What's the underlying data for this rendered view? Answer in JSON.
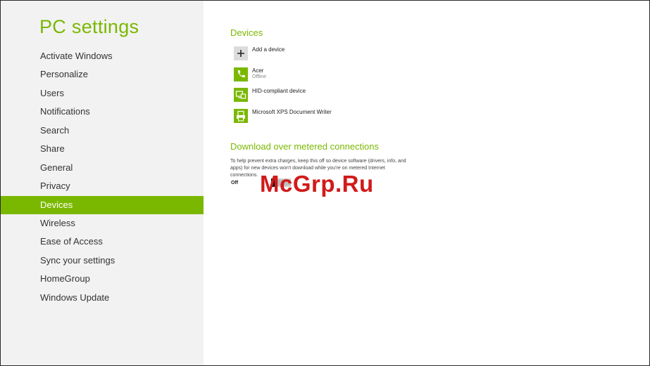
{
  "app_title": "PC settings",
  "nav": {
    "items": [
      {
        "label": "Activate Windows"
      },
      {
        "label": "Personalize"
      },
      {
        "label": "Users"
      },
      {
        "label": "Notifications"
      },
      {
        "label": "Search"
      },
      {
        "label": "Share"
      },
      {
        "label": "General"
      },
      {
        "label": "Privacy"
      },
      {
        "label": "Devices",
        "selected": true
      },
      {
        "label": "Wireless"
      },
      {
        "label": "Ease of Access"
      },
      {
        "label": "Sync your settings"
      },
      {
        "label": "HomeGroup"
      },
      {
        "label": "Windows Update"
      }
    ]
  },
  "devices": {
    "title": "Devices",
    "add_label": "Add a device",
    "list": [
      {
        "name": "Acer",
        "status": "Offline",
        "icon": "phone-icon"
      },
      {
        "name": "HID-compliant device",
        "status": "",
        "icon": "hid-device-icon"
      },
      {
        "name": "Microsoft XPS Document Writer",
        "status": "",
        "icon": "printer-icon"
      }
    ]
  },
  "metered": {
    "title": "Download over metered connections",
    "description": "To help prevent extra charges, keep this off so device software (drivers, info, and apps) for new devices won't download while you're on metered Internet connections.",
    "toggle_state": "Off"
  },
  "watermark": "McGrp.Ru",
  "colors": {
    "accent": "#7ab800",
    "left_pane_bg": "#f2f2f2",
    "watermark": "#d11a1a"
  }
}
